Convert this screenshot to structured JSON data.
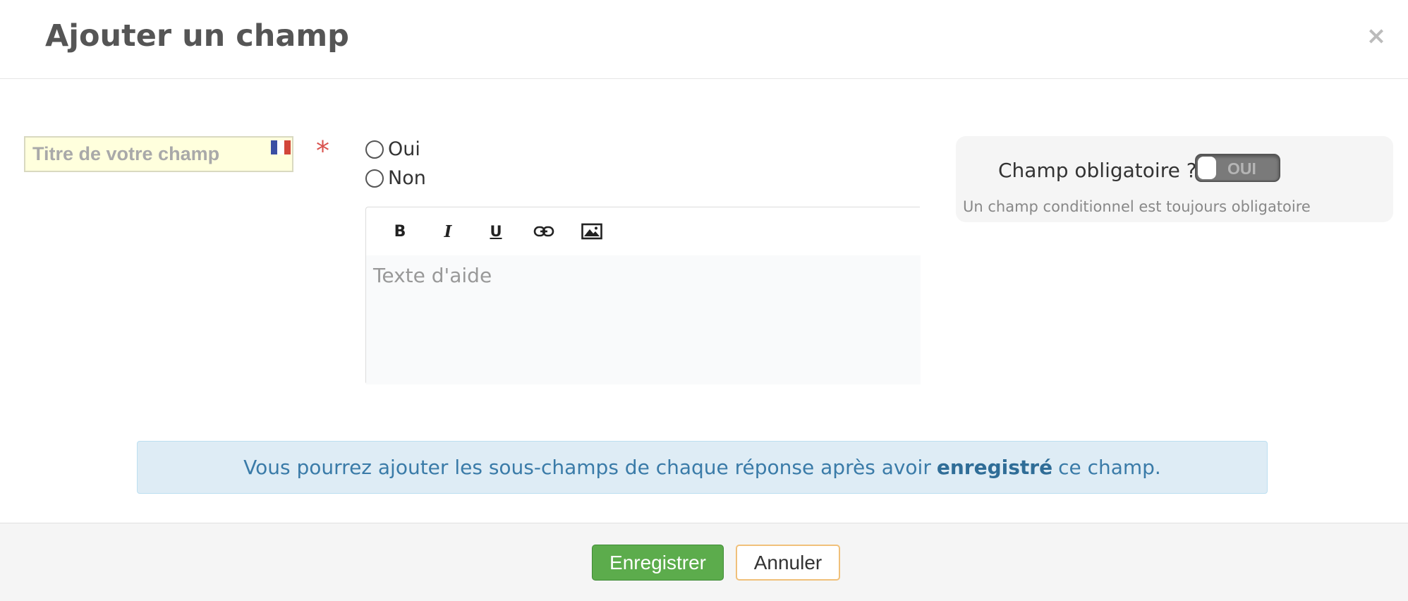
{
  "modal": {
    "title": "Ajouter un champ",
    "close_symbol": "×"
  },
  "field": {
    "title_placeholder": "Titre de votre champ",
    "flag_icon": "french-flag-icon",
    "required_marker": "*"
  },
  "options": [
    {
      "label": "Oui",
      "selected": false
    },
    {
      "label": "Non",
      "selected": false
    }
  ],
  "editor": {
    "toolbar": {
      "bold": "B",
      "italic": "I",
      "underline": "U",
      "link_icon": "link-icon",
      "image_icon": "image-icon"
    },
    "placeholder": "Texte d'aide"
  },
  "required_panel": {
    "label": "Champ obligatoire ?",
    "toggle_text": "OUI",
    "toggle_on": false,
    "help": "Un champ conditionnel est toujours obligatoire"
  },
  "info": {
    "text_before": "Vous pourrez ajouter les sous-champs de chaque réponse après avoir",
    "text_bold": "enregistré",
    "text_after": "ce champ."
  },
  "footer": {
    "save_label": "Enregistrer",
    "cancel_label": "Annuler"
  },
  "colors": {
    "save_button": "#5cac4c",
    "cancel_border": "#f0c07a",
    "info_background": "#deecf5",
    "info_text": "#3a7ba8",
    "required_star": "#d9534f",
    "title_input_background": "#ffffdd"
  }
}
